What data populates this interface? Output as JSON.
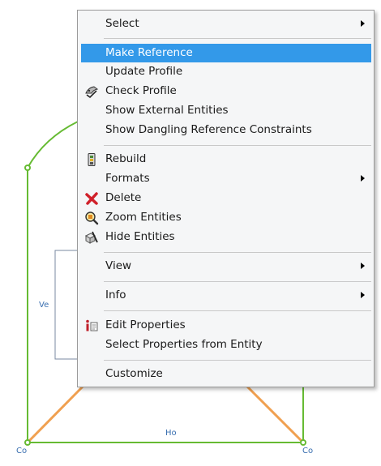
{
  "sketch": {
    "label_ve": "Ve",
    "label_ho": "Ho",
    "label_co_left": "Co",
    "label_co_right": "Co",
    "colors": {
      "green": "#66bb33",
      "orange": "#f0a050",
      "frame": "#7a8aa0"
    }
  },
  "menu": {
    "highlight_color": "#3399e9",
    "items": {
      "select": "Select",
      "make_reference": "Make Reference",
      "update_profile": "Update Profile",
      "check_profile": "Check Profile",
      "show_external": "Show External Entities",
      "show_dangling": "Show Dangling Reference Constraints",
      "rebuild": "Rebuild",
      "formats": "Formats",
      "delete": "Delete",
      "zoom_entities": "Zoom Entities",
      "hide_entities": "Hide Entities",
      "view": "View",
      "info": "Info",
      "edit_properties": "Edit Properties",
      "select_properties": "Select Properties from Entity",
      "customize": "Customize"
    },
    "icons": {
      "check_profile": "check-profile-icon",
      "rebuild": "rebuild-icon",
      "delete": "delete-icon",
      "zoom_entities": "zoom-icon",
      "hide_entities": "hide-icon",
      "edit_properties": "properties-icon"
    }
  }
}
